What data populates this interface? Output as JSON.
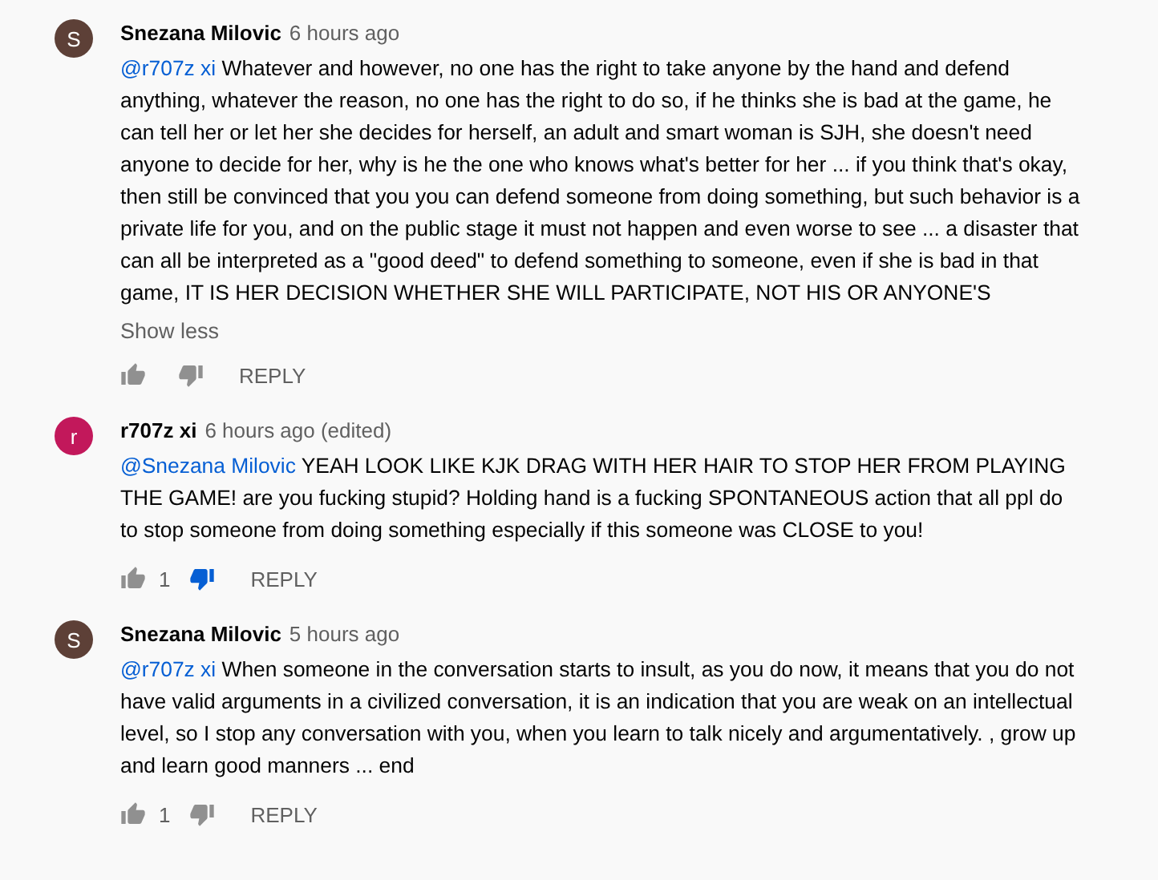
{
  "comments": [
    {
      "avatar": "S",
      "color": "#5d4037",
      "author": "Snezana Milovic",
      "time": "6 hours ago",
      "mention": "@r707z xi",
      "text": "Whatever and however, no one has the right to take anyone by the hand and defend anything, whatever the reason, no one has the right to do so, if he thinks she is bad at the game, he can tell her or let her she decides for herself, an adult and smart woman is SJH, she doesn't need anyone to decide for her, why is he the one who knows what's better for her ... if you think that's okay, then still be convinced that you you can defend someone from doing something, but such behavior is a private life for you, and on the public stage it must not happen and even worse to see ... a disaster that can all be interpreted as a \"good deed\" to defend something to someone, even if she is bad in that game, IT IS HER DECISION WHETHER SHE WILL PARTICIPATE, NOT HIS OR ANYONE'S",
      "toggle": "Show less",
      "liked": false,
      "disliked": false,
      "reply": "REPLY"
    },
    {
      "avatar": "r",
      "color": "#c2185b",
      "author": "r707z xi",
      "time": "6 hours ago (edited)",
      "mention": "@Snezana Milovic",
      "text": "YEAH LOOK LIKE KJK DRAG WITH HER HAIR TO STOP HER FROM PLAYING THE GAME! are you fucking stupid? Holding hand is a fucking SPONTANEOUS action that all ppl do to stop someone from doing something especially if this someone was CLOSE to you!",
      "likes": "1",
      "liked": false,
      "disliked": true,
      "reply": "REPLY"
    },
    {
      "avatar": "S",
      "color": "#5d4037",
      "author": "Snezana Milovic",
      "time": "5 hours ago",
      "mention": "@r707z xi",
      "text": "When someone in the conversation starts to insult, as you do now, it means that you do not have valid arguments in a civilized conversation, it is an indication that you are weak on an intellectual level, so I stop any conversation with you, when you learn to talk nicely and argumentatively. , grow up and learn good manners ... end",
      "likes": "1",
      "liked": false,
      "disliked": false,
      "reply": "REPLY"
    }
  ]
}
